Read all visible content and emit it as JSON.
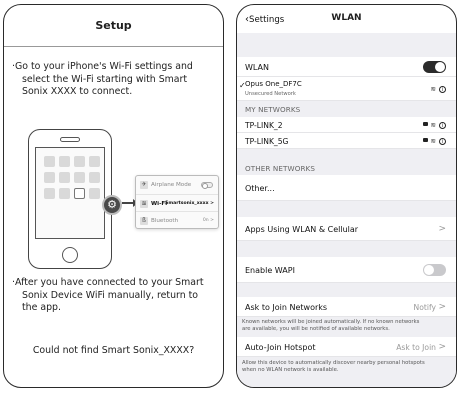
{
  "left": {
    "title": "Setup",
    "instruction1_line1": "Go to your iPhone's Wi-Fi settings and",
    "instruction1_line2": "select the Wi-Fi starting with Smart",
    "instruction1_line3": "Sonix XXXX to connect.",
    "bullet": "·",
    "instruction2_line1": "After you have connected to your Smart",
    "instruction2_line2": "Sonix Device WiFi manually, return to",
    "instruction2_line3": "the app.",
    "not_found_link": "Could not find Smart Sonix_XXXX?",
    "illustration": {
      "gear_icon": "⚙",
      "rows": [
        {
          "label": "Airplane Mode",
          "value": "",
          "icon": "airplane-icon",
          "glyph": "✈"
        },
        {
          "label": "Wi-Fi",
          "value": "Smartsonix_xxxx >",
          "icon": "wifi-icon",
          "glyph": "≋"
        },
        {
          "label": "Bluetooth",
          "value": "0n >",
          "icon": "bluetooth-icon",
          "glyph": "ß"
        }
      ]
    }
  },
  "right": {
    "back_label": "Settings",
    "nav_title": "WLAN",
    "wlan_label": "WLAN",
    "wlan_toggle": true,
    "connected_network": {
      "name": "Opus One_DF7C",
      "subtitle": "Unsecured Network"
    },
    "my_networks_header": "MY NETWORKS",
    "my_networks": [
      "TP-LINK_2",
      "TP-LINK_5G"
    ],
    "other_networks_header": "OTHER NETWORKS",
    "other_label": "Other...",
    "apps_label": "Apps Using WLAN & Cellular",
    "enable_wapi_label": "Enable WAPI",
    "enable_wapi_toggle": false,
    "ask_join_label": "Ask to Join Networks",
    "ask_join_value": "Notify",
    "ask_join_note_line1": "Known networks will be joined automatically. If no known networks",
    "ask_join_note_line2": "are available, you will be notified of available networks.",
    "auto_join_label": "Auto-Join Hotspot",
    "auto_join_value": "Ask to Join",
    "auto_join_note_line1": "Allow this device to automatically discover nearby personal hotspots",
    "auto_join_note_line2": "when no WLAN network is available.",
    "chevron": ">",
    "checkmark": "✓",
    "info_glyph": "i",
    "wifi_glyph": "≋"
  }
}
